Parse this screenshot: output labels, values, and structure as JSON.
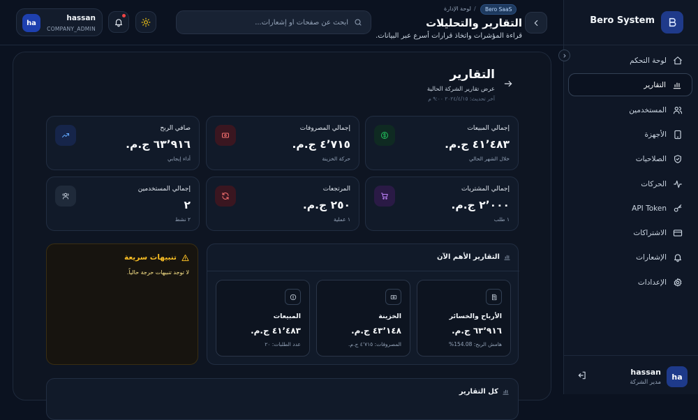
{
  "brand": {
    "name": "Bero System",
    "logo_icon": "b-logo-icon"
  },
  "sidebar": {
    "items": [
      {
        "label": "لوحة التحكم",
        "icon": "home-icon"
      },
      {
        "label": "التقارير",
        "icon": "bar-chart-icon",
        "active": true
      },
      {
        "label": "المستخدمين",
        "icon": "users-icon"
      },
      {
        "label": "الأجهزة",
        "icon": "tablet-icon"
      },
      {
        "label": "الصلاحيات",
        "icon": "shield-icon"
      },
      {
        "label": "الحركات",
        "icon": "activity-icon"
      },
      {
        "label": "API Token",
        "icon": "key-icon"
      },
      {
        "label": "الاشتراكات",
        "icon": "credit-card-icon"
      },
      {
        "label": "الإشعارات",
        "icon": "bell-icon"
      },
      {
        "label": "الإعدادات",
        "icon": "gear-icon"
      }
    ],
    "user": {
      "initials": "ha",
      "name": "hassan",
      "role": "مدير الشركة"
    }
  },
  "header": {
    "user": {
      "initials": "ha",
      "name": "hassan",
      "role": "COMPANY_ADMIN"
    },
    "search_placeholder": "ابحث عن صفحات أو إشعارات...",
    "breadcrumb": {
      "badge": "Bero SaaS",
      "page": "لوحة الإدارة"
    },
    "title": "التقارير والتحليلات",
    "subtitle": "قراءة المؤشرات واتخاذ قرارات أسرع عبر البيانات."
  },
  "reports": {
    "title": "التقارير",
    "subtitle": "عرض تقارير الشركة الحالية",
    "updated": "آخر تحديث: ٢٠٢٤/٤/١٥ ٩:٠٠ م"
  },
  "stats": [
    {
      "label": "إجمالي المبيعات",
      "value": "٤١٬٤٨٣ ج.م.",
      "hint": "خلال الشهر الحالي",
      "icon": "dollar-icon",
      "color": "#22c55e",
      "bg": "#0f2a22"
    },
    {
      "label": "إجمالي المصروفات",
      "value": "٤٬٧١٥ ج.م.",
      "hint": "حركة الخزينة",
      "icon": "banknote-icon",
      "color": "#f87171",
      "bg": "#3a1620"
    },
    {
      "label": "صافي الربح",
      "value": "٦٣٬٩١٦ ج.م.",
      "hint": "أداء إيجابي",
      "icon": "trending-up-icon",
      "color": "#60a5fa",
      "bg": "#16254a"
    },
    {
      "label": "إجمالي المشتريات",
      "value": "٢٬٠٠٠ ج.م.",
      "hint": "١ طلب",
      "icon": "cart-icon",
      "color": "#c084fc",
      "bg": "#2a1a45"
    },
    {
      "label": "المرتجعات",
      "value": "٢٥٠ ج.م.",
      "hint": "١ عملية",
      "icon": "refresh-icon",
      "color": "#f87171",
      "bg": "#3a1620"
    },
    {
      "label": "إجمالي المستخدمين",
      "value": "٢",
      "hint": "٢ نشط",
      "icon": "users-icon",
      "color": "#cbd5e1",
      "bg": "#1f2a3a"
    }
  ],
  "alerts": {
    "title": "تنبيهات سريعة",
    "text": "لا توجد تنبيهات حرجة حالياً."
  },
  "top_reports": {
    "title": "التقارير الأهم الآن",
    "cards": [
      {
        "name": "الأرباح والخسائر",
        "value": "٦٣٬٩١٦ ج.م.",
        "hint": "هامش الربح: 154.08%",
        "icon": "document-icon"
      },
      {
        "name": "الخزينة",
        "value": "٤٣٬١٤٨ ج.م.",
        "hint": "المصروفات: ٤٬٧١٥ ج.م.",
        "icon": "banknote-icon"
      },
      {
        "name": "المبيعات",
        "value": "٤١٬٤٨٣ ج.م.",
        "hint": "عدد الطلبات: ٢٠",
        "icon": "coin-icon"
      }
    ]
  },
  "all_reports": {
    "title": "كل التقارير"
  }
}
